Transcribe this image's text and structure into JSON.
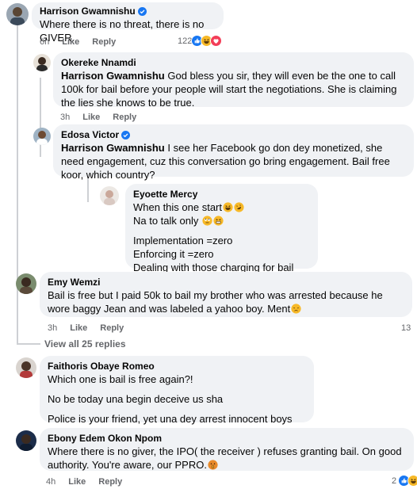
{
  "comments": [
    {
      "author": "Harrison Gwamnishu",
      "verified": true,
      "text": "Where there is no threat, there is no GIVER.",
      "time": "6h",
      "like": "Like",
      "reply": "Reply",
      "reaction_count": "122"
    },
    {
      "author": "Okereke Nnamdi",
      "mention": "Harrison Gwamnishu",
      "text": " God bless you sir, they will even be the one to call 100k for bail before your people will start the negotiations. She is claiming the lies she knows to be true.",
      "time": "3h",
      "like": "Like",
      "reply": "Reply"
    },
    {
      "author": "Edosa Victor",
      "verified": true,
      "mention": "Harrison Gwamnishu",
      "text": " I see her Facebook go don dey monetized, she need engagement, cuz this conversation go bring engagement. Bail free koor, which country?"
    },
    {
      "author": "Eyoette Mercy",
      "line1": "When this one start",
      "line2": "Na to talk only ",
      "line3": "Implementation =zero",
      "line4": "Enforcing it =zero",
      "line5": "Dealing with those charging for bail =zero"
    },
    {
      "author": "Emy Wemzi",
      "text": "Bail is free but I paid 50k to bail my brother who was arrested because he wore baggy Jean and was labeled a yahoo boy. Ment",
      "time": "3h",
      "like": "Like",
      "reply": "Reply",
      "reaction_count": "13"
    },
    {
      "author": "Faithoris Obaye Romeo",
      "line1": "Which one is bail is free again?!",
      "line2": "No be today una begin deceive us sha",
      "line3": "Police is your friend, yet una dey arrest innocent boys for road"
    },
    {
      "author": "Ebony Edem Okon Npom",
      "text": "Where there is no giver, the IPO( the receiver ) refuses granting bail. On good authority. You're aware, our PPRO.",
      "time": "4h",
      "like": "Like",
      "reply": "Reply",
      "reaction_count": "2"
    }
  ],
  "view_all": "View all 25 replies",
  "colors": {
    "bubble": "#f0f2f5",
    "meta": "#65676b",
    "verified": "#1877f2",
    "like_blue": "#1877f2",
    "love_red": "#f33e58",
    "haha_yellow": "#f7b928"
  }
}
